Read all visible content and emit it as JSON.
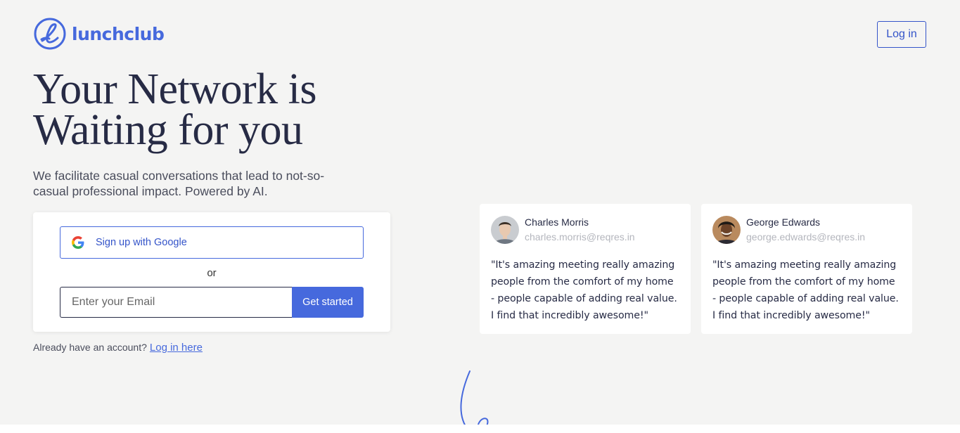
{
  "brand": {
    "name": "lunchclub",
    "color": "#4669dd",
    "logo_icon": "lunchclub-loop-logo"
  },
  "header": {
    "login_label": "Log in"
  },
  "hero": {
    "title": "Your Network is Waiting for you",
    "subtitle": "We facilitate casual conversations that lead to not-so-casual professional impact. Powered by AI."
  },
  "signup": {
    "google_label": "Sign up with Google",
    "google_icon": "google-g-icon",
    "or_label": "or",
    "email_placeholder": "Enter your Email",
    "email_value": "",
    "submit_label": "Get started",
    "already_text": "Already have an account?",
    "login_link_label": "Log in here"
  },
  "testimonials": [
    {
      "name": "Charles Morris",
      "email": "charles.morris@reqres.in",
      "quote": "\"It's amazing meeting really amazing people from the comfort of my home - people capable of adding real value. I find that incredibly awesome!\""
    },
    {
      "name": "George Edwards",
      "email": "george.edwards@reqres.in",
      "quote": "\"It's amazing meeting really amazing people from the comfort of my home - people capable of adding real value. I find that incredibly awesome!\""
    }
  ],
  "colors": {
    "background": "#f4f4f3",
    "heading": "#272b45",
    "accent": "#4669dd"
  }
}
